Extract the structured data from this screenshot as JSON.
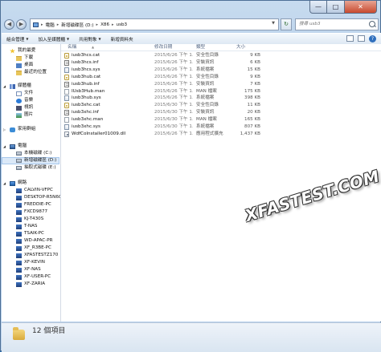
{
  "window": {
    "controls": {
      "minimize": "—",
      "maximize": "□",
      "close": "✕"
    }
  },
  "address": {
    "back": "◀",
    "forward": "▶",
    "segments": [
      "電腦",
      "新增磁碟區 (D:)",
      "X86",
      "usb3"
    ],
    "refresh": "↻"
  },
  "search": {
    "placeholder": "搜尋 usb3"
  },
  "toolbar": {
    "organize": "組合管理",
    "include_library": "加入至媒體櫃",
    "share_with": "共用對象",
    "new_folder": "新增資料夾"
  },
  "sidebar": {
    "favorites": {
      "label": "我的最愛",
      "items": [
        "下載",
        "桌面",
        "最近的位置"
      ]
    },
    "libraries": {
      "label": "媒體櫃",
      "items": [
        "文件",
        "音樂",
        "視訊",
        "圖片"
      ]
    },
    "homegroup": {
      "label": "家用群組"
    },
    "computer": {
      "label": "電腦",
      "items": [
        "本機磁碟 (C:)",
        "新增磁碟區 (D:)",
        "抽取式磁碟 (E:)"
      ]
    },
    "network": {
      "label": "網路",
      "items": [
        "CALVIN-VFPC",
        "DESKTOP-R5N6QC",
        "FREDDIE-PC",
        "FXCD9877",
        "KJ-T430S",
        "T-NAS",
        "TSAIK-PC",
        "WD-APAC-PR",
        "XF_R3BE-PC",
        "XFASTESTZ170",
        "XF-KEVIN",
        "XF-NAS",
        "XF-USER-PC",
        "XF-ZARIA"
      ]
    }
  },
  "columns": {
    "name": "名稱",
    "date": "修改日期",
    "type": "類型",
    "size": "大小"
  },
  "files": [
    {
      "icon": "cat",
      "name": "iusb3hcs.cat",
      "date": "2015/6/26 下午 1...",
      "type": "安全性目錄",
      "size": "9 KB"
    },
    {
      "icon": "inf",
      "name": "iusb3hcs.inf",
      "date": "2015/6/26 下午 1...",
      "type": "安裝資訊",
      "size": "6 KB"
    },
    {
      "icon": "sys",
      "name": "iusb3hcs.sys",
      "date": "2015/6/26 下午 1...",
      "type": "系統檔案",
      "size": "15 KB"
    },
    {
      "icon": "cat",
      "name": "iusb3hub.cat",
      "date": "2015/6/26 下午 1...",
      "type": "安全性目錄",
      "size": "9 KB"
    },
    {
      "icon": "inf",
      "name": "iusb3hub.inf",
      "date": "2015/6/26 下午 1...",
      "type": "安裝資訊",
      "size": "7 KB"
    },
    {
      "icon": "man",
      "name": "IUsb3Hub.man",
      "date": "2015/6/26 下午 1...",
      "type": "MAN 檔案",
      "size": "175 KB"
    },
    {
      "icon": "sys",
      "name": "iusb3hub.sys",
      "date": "2015/6/26 下午 1...",
      "type": "系統檔案",
      "size": "398 KB"
    },
    {
      "icon": "cat",
      "name": "iusb3xhc.cat",
      "date": "2015/6/30 下午 1...",
      "type": "安全性目錄",
      "size": "11 KB"
    },
    {
      "icon": "inf",
      "name": "iusb3xhc.inf",
      "date": "2015/6/30 下午 1...",
      "type": "安裝資訊",
      "size": "20 KB"
    },
    {
      "icon": "man",
      "name": "iusb3xhc.man",
      "date": "2015/6/30 下午 1...",
      "type": "MAN 檔案",
      "size": "165 KB"
    },
    {
      "icon": "sys",
      "name": "iusb3xhc.sys",
      "date": "2015/6/30 下午 1...",
      "type": "系統檔案",
      "size": "807 KB"
    },
    {
      "icon": "dll",
      "name": "WdfCoInstaller01009.dll",
      "date": "2015/6/26 下午 1...",
      "type": "應用程式擴充",
      "size": "1,437 KB"
    }
  ],
  "watermark": "XFASTEST.COM",
  "status": {
    "count": "12 個項目"
  }
}
